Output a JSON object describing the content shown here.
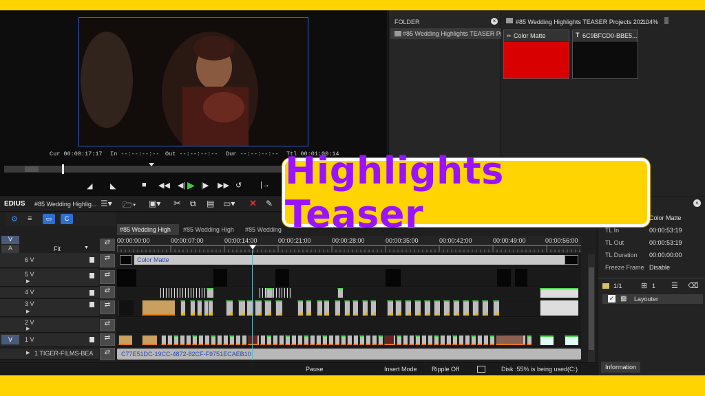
{
  "player": {
    "cur_label": "Cur",
    "cur_value": "00:00:17:17",
    "in_label": "In",
    "in_value": "--:--:--:--",
    "out_label": "Out",
    "out_value": "--:--:--:--",
    "dur_label": "Dur",
    "dur_value": "--:--:--:--",
    "ttl_label": "Ttl",
    "ttl_value": "00:01:00:14"
  },
  "bin": {
    "folder_header": "FOLDER",
    "folder_item": "#85 Wedding Highlights TEASER Pr",
    "path": "#85 Wedding Highlights TEASER Projects 202...",
    "zoom": "104%",
    "clips": [
      {
        "label": "Color Matte",
        "color": "#d80000"
      },
      {
        "label": "6C9BFCD0-BBE5...",
        "color": "#0c0c0c"
      }
    ]
  },
  "timeline": {
    "app_name": "EDIUS",
    "project_name": "#85 Wedding Highlig...",
    "tabs": [
      "#85 Wedding High",
      "#85 Wedding High",
      "#85 Wedding"
    ],
    "fit_label": "Fit",
    "ruler": [
      "00:00:00:00",
      "00:00:07:00",
      "00:00:14:00",
      "00:00:21:00",
      "00:00:28:00",
      "00:00:35:00",
      "00:00:42:00",
      "00:00:49:00",
      "00:00:56:00"
    ],
    "tracks": [
      "6 V",
      "5 V",
      "4 V",
      "3 V",
      "2 V",
      "1 V"
    ],
    "v_label": "V",
    "a_label": "A",
    "color_matte_clip": "Color Matte",
    "audio_track_name": "1  TIGER-FILMS-BEA",
    "audio_clip_name": "C77E51DC-19CC-4872-82CF-F9751ECAEB10"
  },
  "info": {
    "rows": [
      {
        "label": "",
        "value": "Color Matte"
      },
      {
        "label": "TL In",
        "value": "00:00:53:19"
      },
      {
        "label": "TL Out",
        "value": "00:00:53:19"
      },
      {
        "label": "TL Duration",
        "value": "00:00:00:00"
      },
      {
        "label": "Freeze Frame",
        "value": "Disable"
      }
    ],
    "page": "1/1",
    "count": "1",
    "effect": "Layouter",
    "tab": "Information"
  },
  "status": {
    "pause": "Pause",
    "insert_mode": "Insert Mode",
    "ripple": "Ripple Off",
    "disk": "Disk :55% is being used(C:)"
  },
  "banner": {
    "text": "Highlights Teaser",
    "text_color": "#9b12ff",
    "bg_color": "#ffd400"
  }
}
